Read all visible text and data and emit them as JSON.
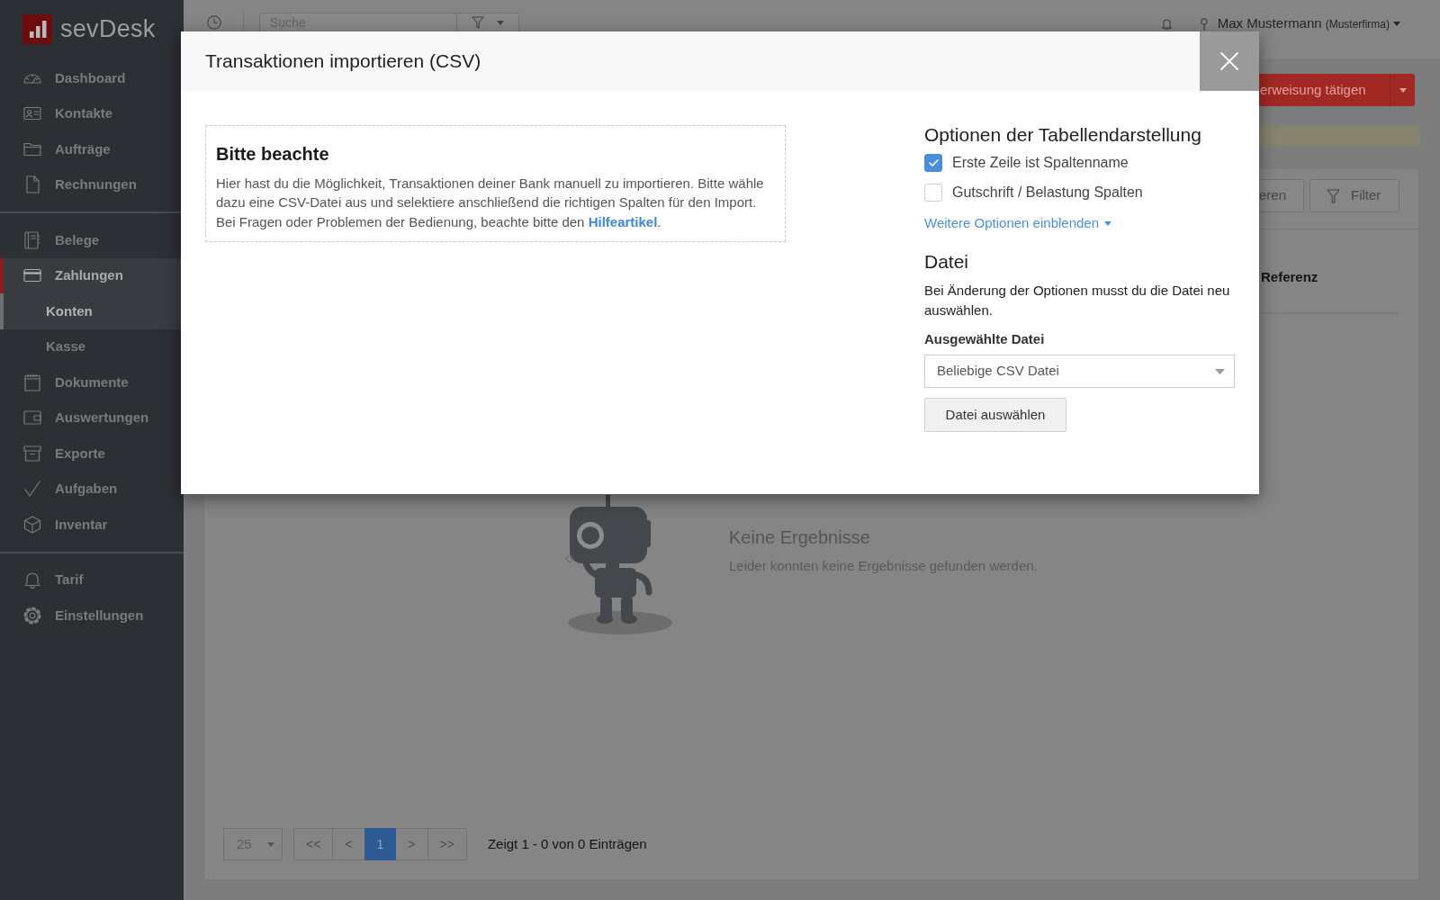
{
  "sidebar": {
    "logo": "sevDesk",
    "groups": [
      {
        "items": [
          {
            "label": "Dashboard",
            "selected": false
          },
          {
            "label": "Kontakte",
            "selected": false
          },
          {
            "label": "Aufträge",
            "selected": false
          },
          {
            "label": "Rechnungen",
            "selected": false
          }
        ]
      },
      {
        "items": [
          {
            "label": "Belege",
            "selected": false
          },
          {
            "label": "Zahlungen",
            "selected": true,
            "children": [
              {
                "label": "Konten",
                "selected": true
              },
              {
                "label": "Kasse",
                "selected": false
              }
            ]
          },
          {
            "label": "Dokumente",
            "selected": false
          },
          {
            "label": "Auswertungen",
            "selected": false
          },
          {
            "label": "Exporte",
            "selected": false
          },
          {
            "label": "Aufgaben",
            "selected": false
          },
          {
            "label": "Inventar",
            "selected": false
          }
        ]
      },
      {
        "items": [
          {
            "label": "Tarif",
            "selected": false
          },
          {
            "label": "Einstellungen",
            "selected": false
          }
        ]
      }
    ]
  },
  "top_bar": {
    "search": {
      "placeholder": "Suche"
    },
    "user": {
      "name": "Max Mustermann",
      "company": "(Musterfirma)"
    }
  },
  "page_actions": {
    "primary_button": "erweisung tätigen"
  },
  "content": {
    "toolbar": {
      "partial_button": "eren",
      "filter_button": "Filter"
    },
    "table": {
      "columns": [
        "Referenz"
      ]
    },
    "empty_state": {
      "title": "Keine Ergebnisse",
      "message": "Leider konnten keine Ergebnisse gefunden werden."
    },
    "pagination": {
      "page_size": "25",
      "pages": [
        {
          "label": "<<",
          "selected": false
        },
        {
          "label": "<",
          "selected": false
        },
        {
          "label": "1",
          "selected": true
        },
        {
          "label": ">",
          "selected": false
        },
        {
          "label": ">>",
          "selected": false
        }
      ],
      "summary": "Zeigt 1 - 0 von 0 Einträgen"
    }
  },
  "modal": {
    "title": "Transaktionen importieren (CSV)",
    "notice": {
      "title": "Bitte beachte",
      "text_before": "Hier hast du die Möglichkeit, Transaktionen deiner Bank manuell zu importieren. Bitte wähle dazu eine CSV-Datei aus und selektiere anschließend die richtigen Spalten für den Import. Bei Fragen oder Problemen der Bedienung, beachte bitte den ",
      "link": "Hilfeartikel",
      "text_after": "."
    },
    "table_options": {
      "title": "Optionen der Tabellendarstellung",
      "checkboxes": [
        {
          "label": "Erste Zeile ist Spaltenname",
          "checked": true
        },
        {
          "label": "Gutschrift / Belastung Spalten",
          "checked": false
        }
      ],
      "more_link": "Weitere Optionen einblenden"
    },
    "file": {
      "title": "Datei",
      "hint": "Bei Änderung der Optionen musst du die Datei neu auswählen.",
      "select_label": "Ausgewählte Datei",
      "select_value": "Beliebige CSV Datei",
      "button": "Datei auswählen"
    }
  }
}
